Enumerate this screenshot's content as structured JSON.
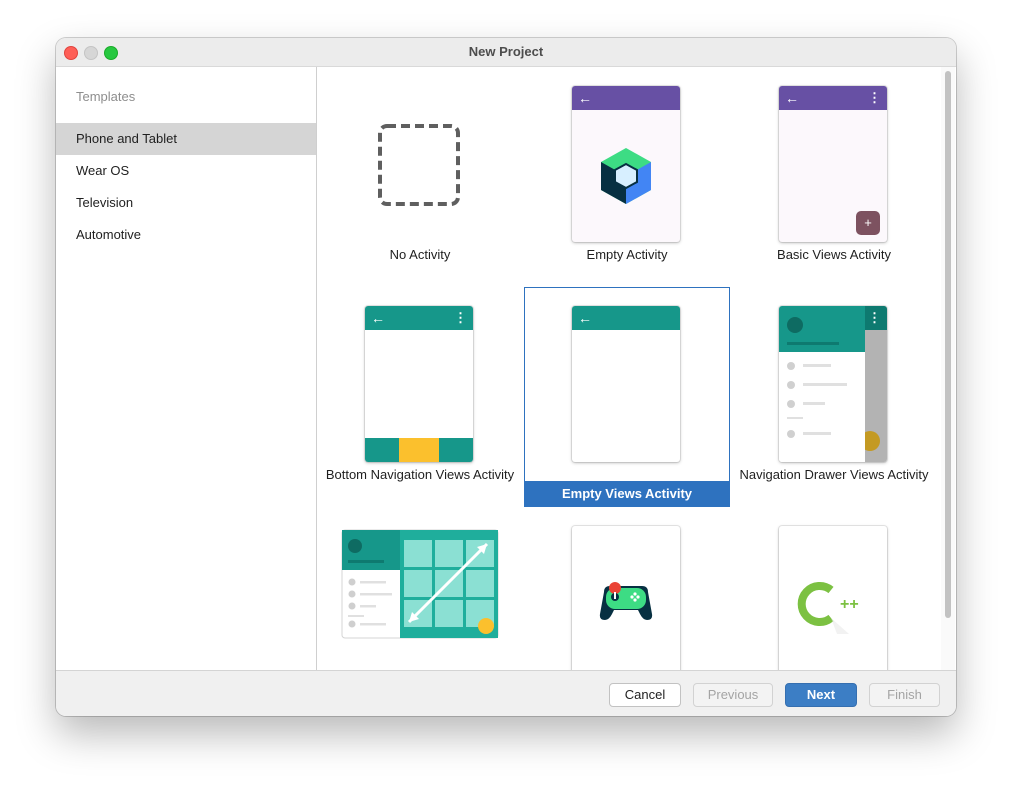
{
  "window": {
    "title": "New Project"
  },
  "sidebar": {
    "heading": "Templates",
    "items": [
      {
        "label": "Phone and Tablet",
        "selected": true
      },
      {
        "label": "Wear OS",
        "selected": false
      },
      {
        "label": "Television",
        "selected": false
      },
      {
        "label": "Automotive",
        "selected": false
      }
    ]
  },
  "templates": [
    {
      "label": "No Activity",
      "icon": "dashed-square-icon"
    },
    {
      "label": "Empty Activity",
      "icon": "jetpack-compose-icon"
    },
    {
      "label": "Basic Views Activity",
      "icon": "basic-views-phone-icon"
    },
    {
      "label": "Bottom Navigation Views Activity",
      "icon": "bottom-navigation-phone-icon"
    },
    {
      "label": "Empty Views Activity",
      "icon": "empty-views-phone-icon",
      "selected": true
    },
    {
      "label": "Navigation Drawer Views Activity",
      "icon": "navigation-drawer-phone-icon"
    },
    {
      "label": "",
      "icon": "responsive-views-tablet-icon"
    },
    {
      "label": "",
      "icon": "game-controller-icon"
    },
    {
      "label": "",
      "icon": "cpp-icon"
    }
  ],
  "icons": {
    "back": "←",
    "overflow": "⋮",
    "plus": "+",
    "cpp": "++"
  },
  "buttons": {
    "cancel": "Cancel",
    "previous": "Previous",
    "next": "Next",
    "finish": "Finish"
  },
  "colors": {
    "selection": "#2e72bf",
    "purple_appbar": "#6750a4",
    "teal_appbar": "#16978a",
    "bottom_nav_active": "#fbc02d",
    "next_button": "#3c7ec5"
  }
}
